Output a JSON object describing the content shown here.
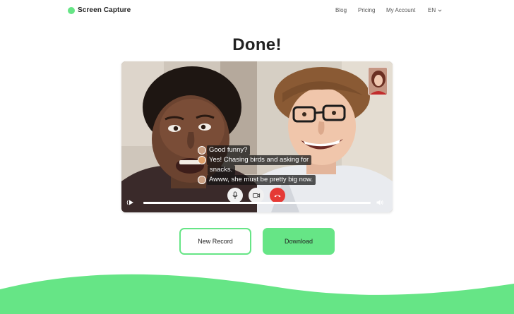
{
  "header": {
    "brand": "Screen Capture",
    "nav": [
      "Blog",
      "Pricing",
      "My Account"
    ],
    "language": "EN"
  },
  "title": "Done!",
  "video": {
    "captions": [
      "Good funny?",
      "Yes! Chasing birds and asking for",
      "snacks.",
      "Awww, she must be pretty big now."
    ],
    "progress": 1.0
  },
  "buttons": {
    "new_record": "New Record",
    "download": "Download"
  },
  "colors": {
    "accent": "#66e586",
    "end_call": "#e53935",
    "text": "#222222"
  },
  "icons": [
    "brand-dot",
    "chevron-down-icon",
    "microphone-icon",
    "video-camera-icon",
    "end-call-icon",
    "play-icon",
    "volume-icon"
  ]
}
